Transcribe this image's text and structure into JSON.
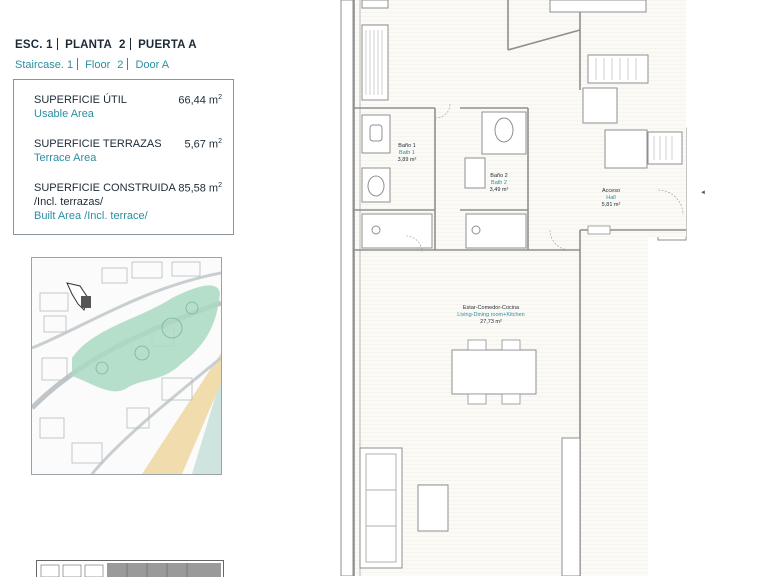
{
  "header": {
    "esc_label": "ESC.",
    "esc_num": "1",
    "planta_label": "PLANTA",
    "planta_num": "2",
    "puerta_label": "PUERTA",
    "puerta_val": "A",
    "staircase_label": "Staircase.",
    "staircase_num": "1",
    "floor_label": "Floor",
    "floor_num": "2",
    "door_label": "Door",
    "door_val": "A"
  },
  "areas": {
    "usable": {
      "label": "SUPERFICIE ÚTIL",
      "sub": "Usable Area",
      "value": "66,44 m",
      "unit_sup": "2"
    },
    "terrace": {
      "label": "SUPERFICIE TERRAZAS",
      "sub": "Terrace Area",
      "value": "5,67 m",
      "unit_sup": "2"
    },
    "built": {
      "label": "SUPERFICIE CONSTRUIDA",
      "label2": "/Incl. terrazas/",
      "sub": "Built Area /Incl. terrace/",
      "value": "85,58 m",
      "unit_sup": "2"
    }
  },
  "rooms": {
    "bath1": {
      "es": "Baño 1",
      "en": "Bath 1",
      "area": "3,89 m²"
    },
    "bath2": {
      "es": "Baño 2",
      "en": "Bath 2",
      "area": "3,49 m²"
    },
    "hall": {
      "es": "Acceso",
      "en": "Hall",
      "area": "5,81 m²"
    },
    "living": {
      "es": "Estar-Comedor-Cocina",
      "en": "Living-Dining room+Kitchen",
      "area": "27,73 m²"
    }
  },
  "entry_marker": "◄"
}
